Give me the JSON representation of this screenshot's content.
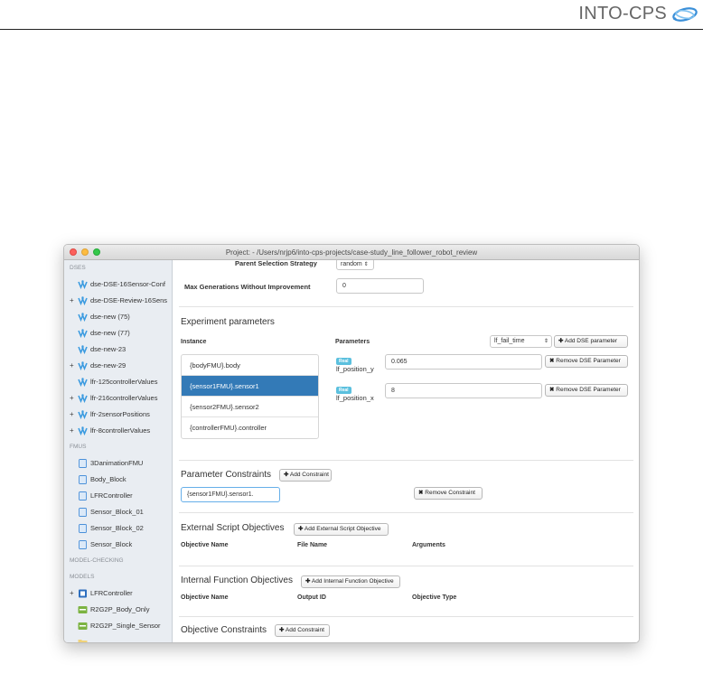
{
  "header": {
    "logo_text": "INTO-CPS"
  },
  "window": {
    "title": "Project: - /Users/nrjp6/into-cps-projects/case-study_line_follower_robot_review"
  },
  "sidebar": {
    "sections": {
      "dses": "DSES",
      "fmus": "FMUS",
      "model_checking": "MODEL-CHECKING",
      "models": "MODELS"
    },
    "dse_items": [
      {
        "label": "dse-DSE-16Sensor-Conf",
        "expandable": false
      },
      {
        "label": "dse-DSE-Review-16Sens",
        "expandable": true
      },
      {
        "label": "dse-new (75)",
        "expandable": false
      },
      {
        "label": "dse-new (77)",
        "expandable": false
      },
      {
        "label": "dse-new-23",
        "expandable": false
      },
      {
        "label": "dse-new-29",
        "expandable": true
      },
      {
        "label": "lfr-125controllerValues",
        "expandable": false
      },
      {
        "label": "lfr-216controllerValues",
        "expandable": true
      },
      {
        "label": "lfr-2sensorPositions",
        "expandable": true
      },
      {
        "label": "lfr-8controllerValues",
        "expandable": true
      }
    ],
    "fmu_items": [
      "3DanimationFMU",
      "Body_Block",
      "LFRController",
      "Sensor_Block_01",
      "Sensor_Block_02",
      "Sensor_Block"
    ],
    "model_items": [
      {
        "label": "LFRController",
        "expandable": true,
        "icon": "model-block-icon"
      },
      {
        "label": "R2G2P_Body_Only",
        "expandable": false,
        "icon": "model-green-icon"
      },
      {
        "label": "R2G2P_Single_Sensor",
        "expandable": false,
        "icon": "model-green-icon"
      },
      {
        "label": "",
        "expandable": false,
        "icon": "folder-icon"
      }
    ]
  },
  "form": {
    "parent_selection_label": "Parent Selection Strategy",
    "parent_selection_value": "random",
    "max_generations_label": "Max Generations Without Improvement",
    "max_generations_value": "0"
  },
  "experiment": {
    "title": "Experiment parameters",
    "instance_header": "Instance",
    "parameters_header": "Parameters",
    "param_select_value": "lf_fail_time",
    "add_param_label": "Add DSE parameter",
    "instances": [
      "{bodyFMU}.body",
      "{sensor1FMU}.sensor1",
      "{sensor2FMU}.sensor2",
      "{controllerFMU}.controller"
    ],
    "selected_index": 1,
    "params": [
      {
        "badge": "Real",
        "name": "lf_position_y",
        "value": "0.065",
        "remove_label": "Remove DSE Parameter"
      },
      {
        "badge": "Real",
        "name": "lf_position_x",
        "value": "8",
        "remove_label": "Remove DSE Parameter"
      }
    ]
  },
  "constraints": {
    "title": "Parameter Constraints",
    "add_label": "Add Constraint",
    "value": "{sensor1FMU}.sensor1.",
    "remove_label": "Remove Constraint"
  },
  "external": {
    "title": "External Script Objectives",
    "add_label": "Add External Script Objective",
    "col1": "Objective Name",
    "col2": "File Name",
    "col3": "Arguments"
  },
  "internal": {
    "title": "Internal Function Objectives",
    "add_label": "Add Internal Function Objective",
    "col1": "Objective Name",
    "col2": "Output ID",
    "col3": "Objective Type"
  },
  "objective_constraints": {
    "title": "Objective Constraints",
    "add_label": "Add Constraint"
  },
  "colors": {
    "accent": "#337ab7",
    "badge": "#5bc0de",
    "dse_icon": "#3b9be0"
  }
}
